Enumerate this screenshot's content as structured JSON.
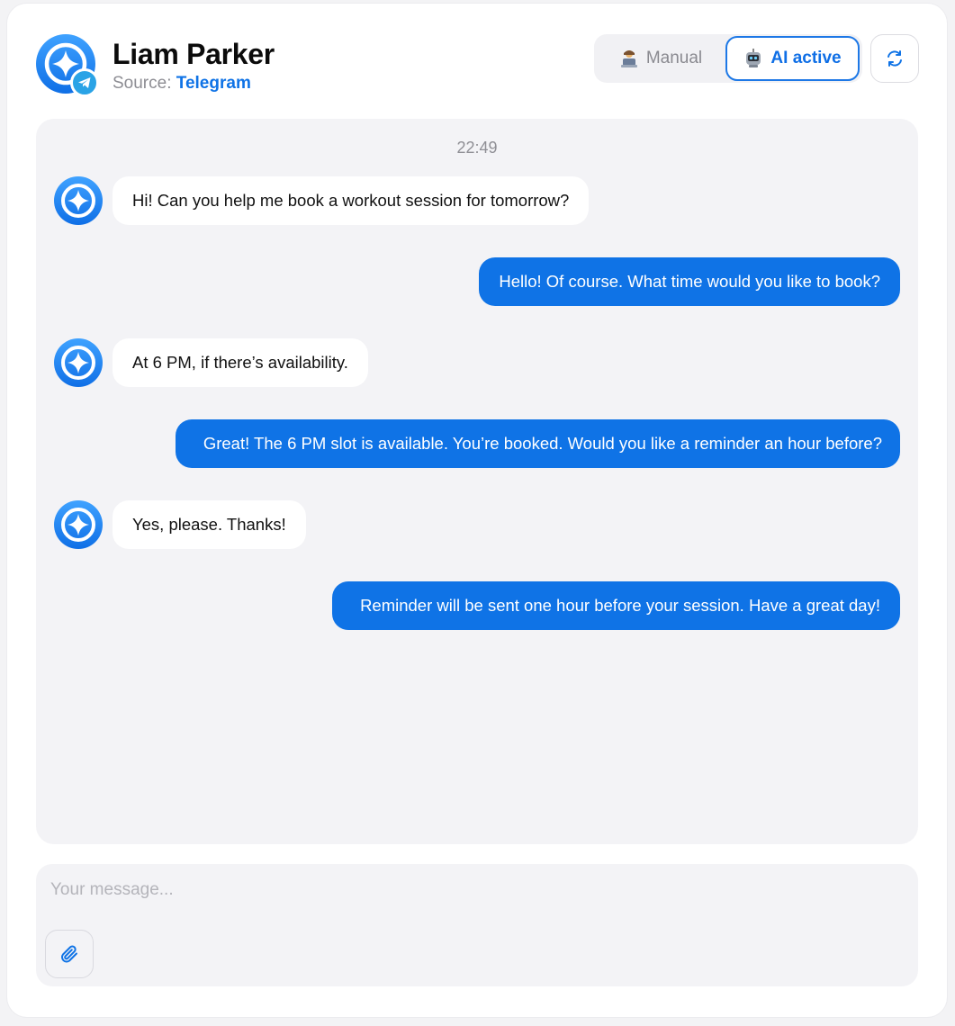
{
  "contact": {
    "name": "Liam Parker",
    "source_label": "Source:",
    "source_value": "Telegram"
  },
  "mode": {
    "manual_label": "Manual",
    "ai_label": "AI active",
    "active": "ai"
  },
  "colors": {
    "accent": "#0f73e6",
    "telegram": "#2aa3e6",
    "chat_bg": "#f3f3f6"
  },
  "icons": {
    "avatar": "brand-logo-icon",
    "source_badge": "telegram-icon",
    "manual": "person-at-laptop-icon",
    "ai": "robot-icon",
    "refresh": "refresh-icon",
    "attach": "paperclip-icon"
  },
  "chat": {
    "timestamp": "22:49",
    "messages": [
      {
        "direction": "in",
        "text": "Hi! Can you help me book a workout session for tomorrow?"
      },
      {
        "direction": "out",
        "text": "Hello! Of course. What time would you like to book?"
      },
      {
        "direction": "in",
        "text": "At 6 PM, if there’s availability."
      },
      {
        "direction": "out",
        "text": "Great! The 6 PM slot is available. You’re booked. Would you like a reminder an hour before?"
      },
      {
        "direction": "in",
        "text": "Yes, please. Thanks!"
      },
      {
        "direction": "out",
        "text": "Reminder will be sent one hour before your session. Have a great day!"
      }
    ]
  },
  "composer": {
    "placeholder": "Your message...",
    "value": ""
  }
}
